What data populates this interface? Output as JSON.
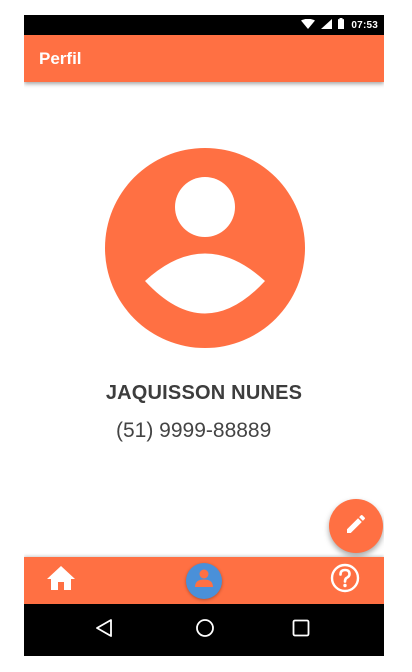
{
  "status_bar": {
    "time": "07:53",
    "icons": [
      "wifi-icon",
      "signal-icon",
      "battery-icon"
    ]
  },
  "app_bar": {
    "title": "Perfil"
  },
  "profile": {
    "avatar_icon": "account-circle-icon",
    "name": "JAQUISSON NUNES",
    "phone": "(51) 9999-88889"
  },
  "fab": {
    "icon": "edit-icon"
  },
  "bottom_nav": {
    "items": [
      {
        "icon": "home-icon",
        "selected": false
      },
      {
        "icon": "profile-icon",
        "selected": true
      },
      {
        "icon": "help-icon",
        "selected": false
      }
    ]
  },
  "system_nav": {
    "icons": [
      "back-icon",
      "home-circle-icon",
      "recents-icon"
    ]
  },
  "colors": {
    "primary": "#ff7043",
    "selected_accent": "#4a90d9",
    "text_dark": "#3d3d3d",
    "system_bar": "#000000"
  }
}
